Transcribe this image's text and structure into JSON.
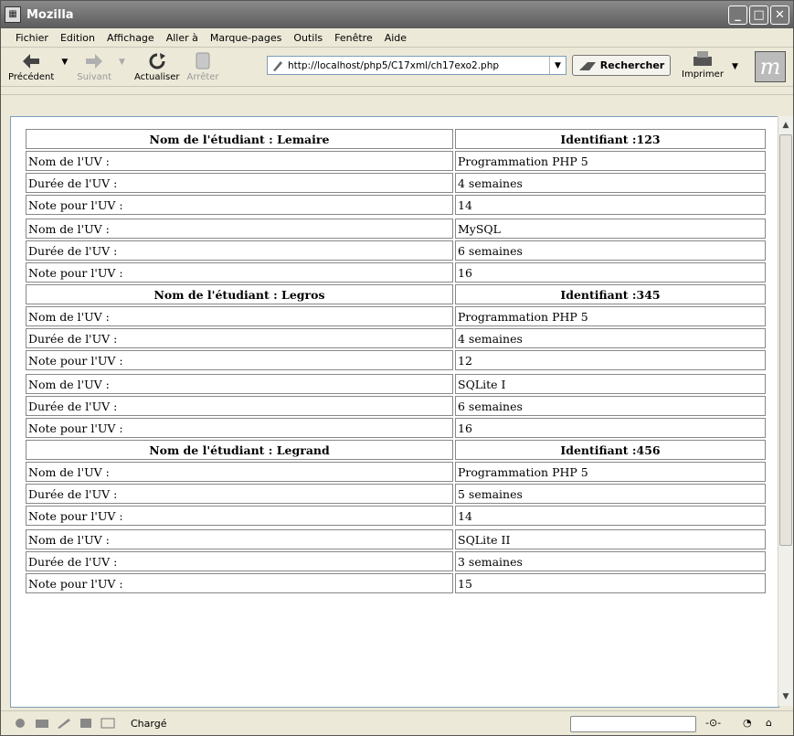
{
  "window": {
    "title": "Mozilla"
  },
  "menu": [
    "Fichier",
    "Edition",
    "Affichage",
    "Aller à",
    "Marque-pages",
    "Outils",
    "Fenêtre",
    "Aide"
  ],
  "toolbar": {
    "back": "Précédent",
    "forward": "Suivant",
    "reload": "Actualiser",
    "stop": "Arrêter",
    "url": "http://localhost/php5/C17xml/ch17exo2.php",
    "search": "Rechercher",
    "print": "Imprimer",
    "logo": "m"
  },
  "students": [
    {
      "name_label": "Nom de l'étudiant : Lemaire",
      "id_label": "Identifiant :123",
      "uvs": [
        {
          "rows": [
            [
              "Nom de l'UV :",
              "Programmation PHP 5"
            ],
            [
              "Durée de l'UV :",
              "4 semaines"
            ],
            [
              "Note pour l'UV :",
              "14"
            ]
          ]
        },
        {
          "rows": [
            [
              "Nom de l'UV :",
              "MySQL"
            ],
            [
              "Durée de l'UV :",
              "6 semaines"
            ],
            [
              "Note pour l'UV :",
              "16"
            ]
          ]
        }
      ]
    },
    {
      "name_label": "Nom de l'étudiant : Legros",
      "id_label": "Identifiant :345",
      "uvs": [
        {
          "rows": [
            [
              "Nom de l'UV :",
              "Programmation PHP 5"
            ],
            [
              "Durée de l'UV :",
              "4 semaines"
            ],
            [
              "Note pour l'UV :",
              "12"
            ]
          ]
        },
        {
          "rows": [
            [
              "Nom de l'UV :",
              "SQLite I"
            ],
            [
              "Durée de l'UV :",
              "6 semaines"
            ],
            [
              "Note pour l'UV :",
              "16"
            ]
          ]
        }
      ]
    },
    {
      "name_label": "Nom de l'étudiant : Legrand",
      "id_label": "Identifiant :456",
      "uvs": [
        {
          "rows": [
            [
              "Nom de l'UV :",
              "Programmation PHP 5"
            ],
            [
              "Durée de l'UV :",
              "5 semaines"
            ],
            [
              "Note pour l'UV :",
              "14"
            ]
          ]
        },
        {
          "rows": [
            [
              "Nom de l'UV :",
              "SQLite II"
            ],
            [
              "Durée de l'UV :",
              "3 semaines"
            ],
            [
              "Note pour l'UV :",
              "15"
            ]
          ]
        }
      ]
    }
  ],
  "status": {
    "text": "Chargé"
  }
}
